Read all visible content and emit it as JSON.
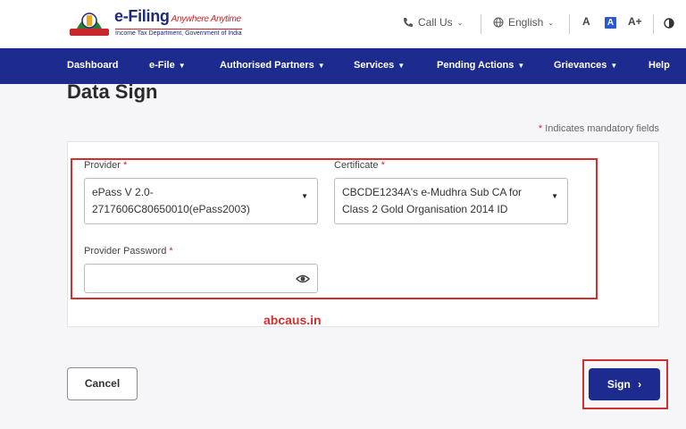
{
  "header": {
    "brand": "e-Filing",
    "tagline": "Anywhere Anytime",
    "subtitle": "Income Tax Department, Government of India",
    "call_us": "Call Us",
    "language": "English",
    "font_decrease": "A",
    "font_normal": "A",
    "font_increase": "A+"
  },
  "nav": {
    "items": [
      {
        "label": "Dashboard"
      },
      {
        "label": "e-File"
      },
      {
        "label": "Authorised Partners"
      },
      {
        "label": "Services"
      },
      {
        "label": "Pending Actions"
      },
      {
        "label": "Grievances"
      },
      {
        "label": "Help"
      }
    ]
  },
  "page": {
    "title": "Data Sign",
    "mandatory_note": "Indicates mandatory fields",
    "star": "*"
  },
  "form": {
    "provider_label": "Provider",
    "provider_value_line1": "ePass V 2.0-",
    "provider_value_line2": "2717606C80650010(ePass2003)",
    "certificate_label": "Certificate",
    "certificate_value_line1": "CBCDE1234A's e-Mudhra Sub CA for",
    "certificate_value_line2": "Class 2 Gold Organisation 2014 ID",
    "password_label": "Provider Password",
    "password_value": ""
  },
  "watermark": "abcaus.in",
  "actions": {
    "cancel": "Cancel",
    "sign": "Sign"
  },
  "colors": {
    "nav_bg": "#1d2b8f",
    "highlight": "#d32f2f",
    "accent": "#2a59d6"
  }
}
